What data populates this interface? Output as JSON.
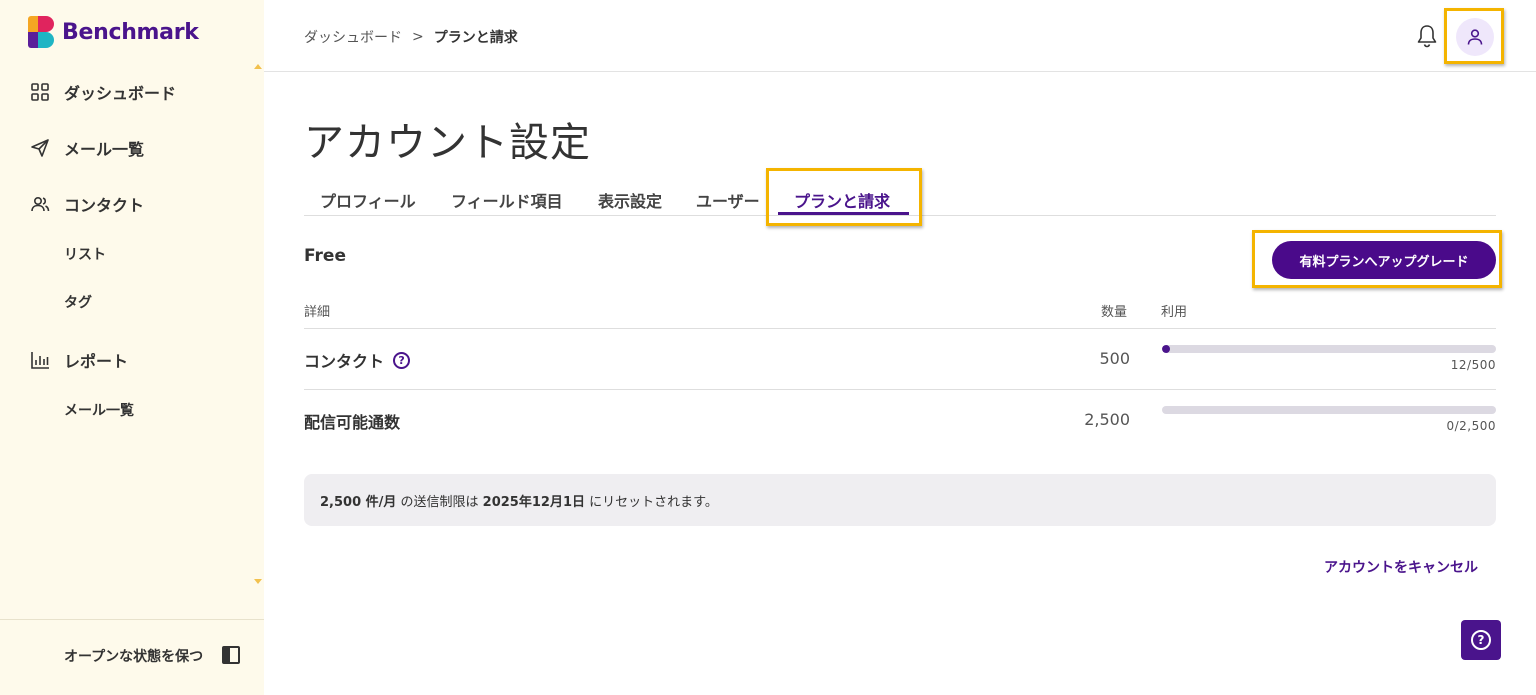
{
  "brand": {
    "name": "Benchmark"
  },
  "sidebar": {
    "items": [
      {
        "label": "ダッシュボード",
        "icon": "grid-icon"
      },
      {
        "label": "メール一覧",
        "icon": "send-icon"
      },
      {
        "label": "コンタクト",
        "icon": "users-icon"
      },
      {
        "label": "リスト"
      },
      {
        "label": "タグ"
      },
      {
        "label": "レポート",
        "icon": "bar-chart-icon"
      },
      {
        "label": "メール一覧"
      }
    ],
    "keep_open_label": "オープンな状態を保つ"
  },
  "header": {
    "breadcrumb": {
      "parent": "ダッシュボード",
      "separator": ">",
      "current": "プランと請求"
    }
  },
  "page": {
    "title": "アカウント設定",
    "tabs": [
      {
        "label": "プロフィール"
      },
      {
        "label": "フィールド項目"
      },
      {
        "label": "表示設定"
      },
      {
        "label": "ユーザー"
      },
      {
        "label": "プランと請求",
        "active": true
      }
    ]
  },
  "plan": {
    "name": "Free",
    "upgrade_label": "有料プランへアップグレード",
    "columns": {
      "detail": "詳細",
      "quantity": "数量",
      "usage": "利用"
    },
    "rows": [
      {
        "label": "コンタクト",
        "quantity": "500",
        "usage_label": "12/500",
        "usage_fraction": 0.024,
        "help": true
      },
      {
        "label": "配信可能通数",
        "quantity": "2,500",
        "usage_label": "0/2,500",
        "usage_fraction": 0
      }
    ],
    "notice": {
      "limit": "2,500 件/月",
      "middle": " の送信制限は ",
      "date": "2025年12月1日",
      "end": " にリセットされます。"
    },
    "cancel_label": "アカウントをキャンセル"
  },
  "colors": {
    "brand_purple": "#4a148c",
    "highlight": "#f4b400",
    "sidebar_bg": "#fefaeb"
  }
}
